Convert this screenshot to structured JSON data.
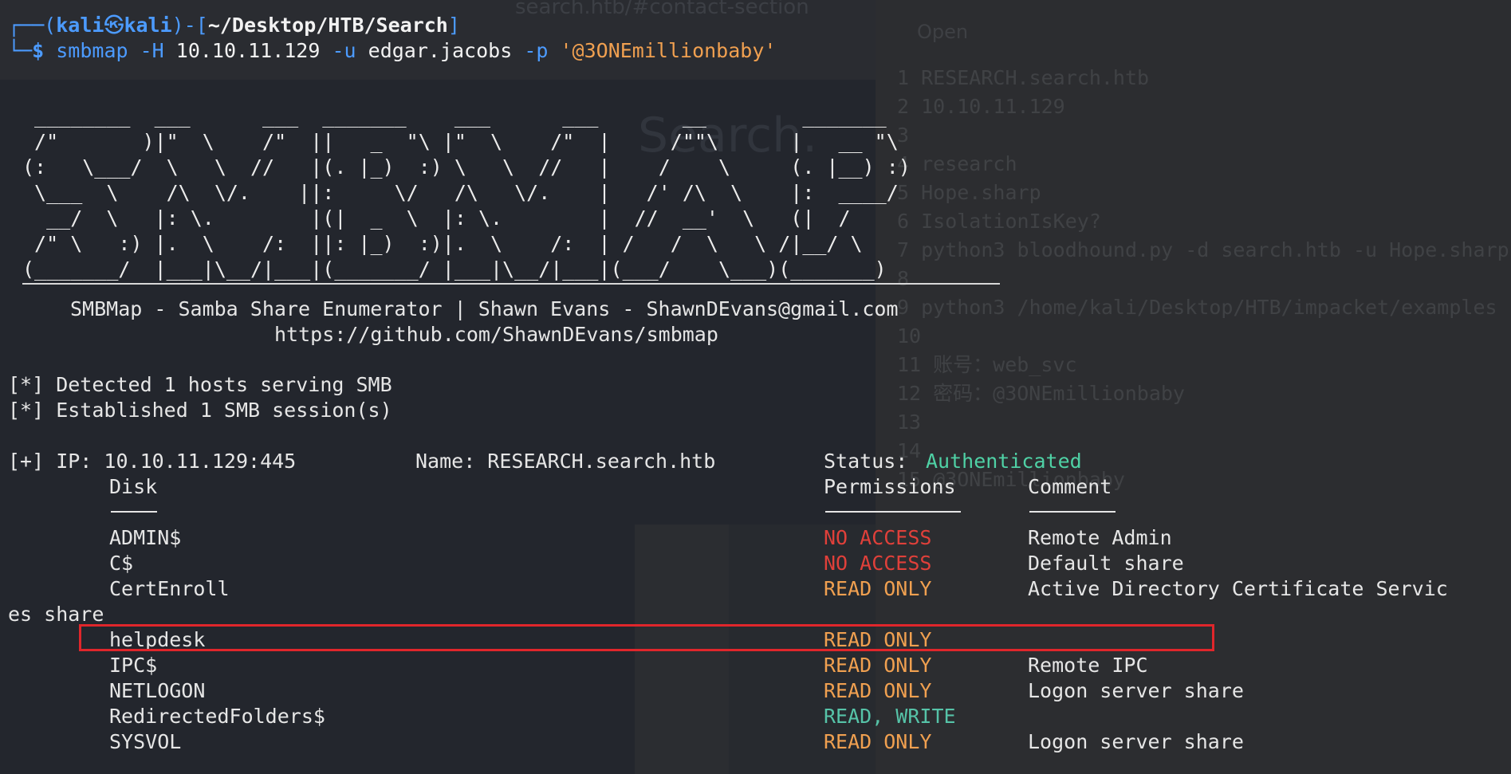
{
  "prompt": {
    "user": "kali",
    "host": "kali",
    "skull": "㉿",
    "cwd": "~/Desktop/HTB/Search",
    "symbol": "$"
  },
  "command": {
    "program": "smbmap",
    "flag_host": "-H",
    "host": "10.10.11.129",
    "flag_user": "-u",
    "user": "edgar.jacobs",
    "flag_pass": "-p",
    "password": "'@3ONEmillionbaby'"
  },
  "banner": {
    "art": " ________  ___      ___  _______    ___      ___       __        _______\n /\"       )|\"  \\    /\"  ||   _  \"\\ |\"  \\    /\"  |     /\"\"\\      |   __ \"\\\n(:   \\___/  \\   \\  //   |(. |_)  :) \\   \\  //   |    /    \\     (. |__) :)\n \\___  \\    /\\  \\/.    ||:     \\/   /\\   \\/.    |   /' /\\  \\    |:  ____/\n  __/  \\   |: \\.        |(|  _  \\  |: \\.        |  //  __'  \\   (|  /\n /\" \\   :) |.  \\    /:  ||: |_)  :)|.  \\    /:  | /   /  \\   \\ /|__/ \\\n(_______/  |___|\\__/|___|(_______/ |___|\\__/|___|(___/    \\___)(_______)",
    "tagline": "SMBMap - Samba Share Enumerator | Shawn Evans - ShawnDEvans@gmail.com",
    "url": "https://github.com/ShawnDEvans/smbmap"
  },
  "status_lines": [
    "[*] Detected 1 hosts serving SMB",
    "[*] Established 1 SMB session(s)"
  ],
  "host_line": {
    "prefix": "[+] IP: 10.10.11.129:445",
    "name": "Name: RESEARCH.search.htb",
    "status_label": "Status:",
    "status_value": "Authenticated"
  },
  "table": {
    "headers": {
      "disk": "Disk",
      "permissions": "Permissions",
      "comment": "Comment"
    },
    "rows": [
      {
        "disk": "ADMIN$",
        "permissions": "NO ACCESS",
        "perm_color": "red",
        "comment": "Remote Admin"
      },
      {
        "disk": "C$",
        "permissions": "NO ACCESS",
        "perm_color": "red",
        "comment": "Default share"
      },
      {
        "disk": "CertEnroll",
        "permissions": "READ ONLY",
        "perm_color": "orange",
        "comment": "Active Directory Certificate Servic",
        "wrap": "es share"
      },
      {
        "disk": "helpdesk",
        "permissions": "READ ONLY",
        "perm_color": "orange",
        "comment": ""
      },
      {
        "disk": "IPC$",
        "permissions": "READ ONLY",
        "perm_color": "orange",
        "comment": "Remote IPC"
      },
      {
        "disk": "NETLOGON",
        "permissions": "READ ONLY",
        "perm_color": "orange",
        "comment": "Logon server share"
      },
      {
        "disk": "RedirectedFolders$",
        "permissions": "READ, WRITE",
        "perm_color": "teal",
        "comment": ""
      },
      {
        "disk": "SYSVOL",
        "permissions": "READ ONLY",
        "perm_color": "orange",
        "comment": "Logon server share"
      }
    ]
  },
  "colors": {
    "prompt_blue": "#4c9bff",
    "authenticated": "#4fd1a5",
    "no_access": "#e0403a",
    "read_only": "#f0a050",
    "read_write": "#56c3a8",
    "highlight_box": "#e0262b"
  },
  "background_ghost": {
    "tab_title": "search.htb/#contact-section",
    "site_title": "Search.",
    "editor_open": "Open",
    "editor_lines": [
      "1 RESEARCH.search.htb",
      "2 10.10.11.129",
      "3",
      "4 research",
      "5 Hope.sharp",
      "6 IsolationIsKey?",
      "7 python3 bloodhound.py -d search.htb -u Hope.sharp",
      "8",
      "9 python3 /home/kali/Desktop/HTB/impacket/examples",
      "10",
      "11 账号：web_svc",
      "12 密码：@3ONEmillionbaby",
      "13",
      "14",
      "15 @3ONEmillionbaby"
    ]
  }
}
